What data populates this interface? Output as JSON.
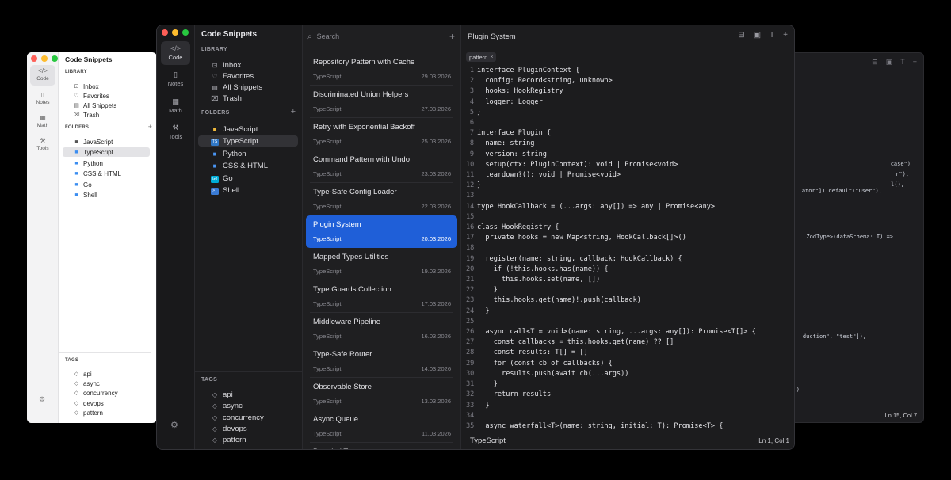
{
  "app_name": "Code Snippets",
  "rail": [
    {
      "label": "Code",
      "icon": "code-icon",
      "glyph": "</>"
    },
    {
      "label": "Notes",
      "icon": "notes-icon",
      "glyph": "▯"
    },
    {
      "label": "Math",
      "icon": "math-icon",
      "glyph": "▦"
    },
    {
      "label": "Tools",
      "icon": "tools-icon",
      "glyph": "⚒"
    }
  ],
  "library": {
    "heading": "LIBRARY",
    "items": [
      {
        "label": "Inbox",
        "icon": "inbox-icon",
        "glyph": "⊡"
      },
      {
        "label": "Favorites",
        "icon": "heart-icon",
        "glyph": "♡"
      },
      {
        "label": "All Snippets",
        "icon": "archive-icon",
        "glyph": "▤"
      },
      {
        "label": "Trash",
        "icon": "trash-icon",
        "glyph": "🗑"
      }
    ]
  },
  "folders": {
    "heading": "FOLDERS",
    "items": [
      {
        "label": "JavaScript",
        "icon": "folder-icon"
      },
      {
        "label": "TypeScript",
        "icon": "typescript-icon",
        "badge": "TS",
        "color": "#3178c6"
      },
      {
        "label": "Python",
        "icon": "python-folder-icon"
      },
      {
        "label": "CSS & HTML",
        "icon": "css-html-folder-icon"
      },
      {
        "label": "Go",
        "icon": "go-icon",
        "badge": "Go",
        "color": "#00add8"
      },
      {
        "label": "Shell",
        "icon": "shell-icon",
        "badge": ">_",
        "color": "#3a7bd5"
      }
    ]
  },
  "tags": {
    "heading": "TAGS",
    "items": [
      "api",
      "async",
      "concurrency",
      "devops",
      "pattern"
    ]
  },
  "search": {
    "placeholder": "Search"
  },
  "snippets": [
    {
      "title": "Repository Pattern with Cache",
      "lang": "TypeScript",
      "date": "29.03.2026"
    },
    {
      "title": "Discriminated Union Helpers",
      "lang": "TypeScript",
      "date": "27.03.2026"
    },
    {
      "title": "Retry with Exponential Backoff",
      "lang": "TypeScript",
      "date": "25.03.2026"
    },
    {
      "title": "Command Pattern with Undo",
      "lang": "TypeScript",
      "date": "23.03.2026"
    },
    {
      "title": "Type-Safe Config Loader",
      "lang": "TypeScript",
      "date": "22.03.2026"
    },
    {
      "title": "Plugin System",
      "lang": "TypeScript",
      "date": "20.03.2026",
      "selected": true
    },
    {
      "title": "Mapped Types Utilities",
      "lang": "TypeScript",
      "date": "19.03.2026"
    },
    {
      "title": "Type Guards Collection",
      "lang": "TypeScript",
      "date": "17.03.2026"
    },
    {
      "title": "Middleware Pipeline",
      "lang": "TypeScript",
      "date": "16.03.2026"
    },
    {
      "title": "Type-Safe Router",
      "lang": "TypeScript",
      "date": "14.03.2026"
    },
    {
      "title": "Observable Store",
      "lang": "TypeScript",
      "date": "13.03.2026"
    },
    {
      "title": "Async Queue",
      "lang": "TypeScript",
      "date": "11.03.2026"
    },
    {
      "title": "Branded Types",
      "lang": "TypeScript",
      "date": ""
    }
  ],
  "editor": {
    "title": "Plugin System",
    "tag": "pattern",
    "language": "TypeScript",
    "cursor": "Ln 1, Col 1",
    "lines": [
      "interface PluginContext {",
      "  config: Record<string, unknown>",
      "  hooks: HookRegistry",
      "  logger: Logger",
      "}",
      "",
      "interface Plugin {",
      "  name: string",
      "  version: string",
      "  setup(ctx: PluginContext): void | Promise<void>",
      "  teardown?(): void | Promise<void>",
      "}",
      "",
      "type HookCallback = (...args: any[]) => any | Promise<any>",
      "",
      "class HookRegistry {",
      "  private hooks = new Map<string, HookCallback[]>()",
      "",
      "  register(name: string, callback: HookCallback) {",
      "    if (!this.hooks.has(name)) {",
      "      this.hooks.set(name, [])",
      "    }",
      "    this.hooks.get(name)!.push(callback)",
      "  }",
      "",
      "  async call<T = void>(name: string, ...args: any[]): Promise<T[]> {",
      "    const callbacks = this.hooks.get(name) ?? []",
      "    const results: T[] = []",
      "    for (const cb of callbacks) {",
      "      results.push(await cb(...args))",
      "    }",
      "    return results",
      "  }",
      "",
      "  async waterfall<T>(name: string, initial: T): Promise<T> {"
    ]
  },
  "back_editor": {
    "fragments": [
      "case\")",
      "r\"),",
      "l(),",
      "ator\"]).default(\"user\"),",
      "ZodType>(dataSchema: T) =>",
      "duction\", \"test\"]),",
      ")"
    ],
    "cursor": "Ln 15, Col 7"
  },
  "colors": {
    "accent": "#1f5fd8",
    "close": "#fe5f57",
    "minimize": "#febc2e",
    "zoom": "#28c840"
  }
}
